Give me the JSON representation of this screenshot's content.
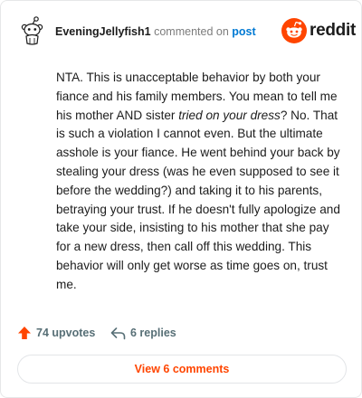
{
  "comment": {
    "username": "EveningJellyfish1",
    "action_text": "commented on",
    "post_link": "post",
    "body_part1": "NTA. This is unacceptable behavior by both your fiance and his family members. You mean to tell me his mother AND sister ",
    "body_emphasis": "tried on your dress",
    "body_part2": "? No. That is such a violation I cannot even. But the ultimate asshole is your fiance. He went behind your back by stealing your dress (was he even supposed to see it before the wedding?) and taking it to his parents, betraying your trust. If he doesn't fully apologize and take your side, insisting to his mother that she pay for a new dress, then call off this wedding. This behavior will only get worse as time goes on, trust me."
  },
  "brand": {
    "wordmark": "reddit",
    "icon": "reddit-alien-logo",
    "color": "#ff4500"
  },
  "actions": {
    "upvotes_label": "74 upvotes",
    "replies_label": "6 replies"
  },
  "footer": {
    "view_comments_label": "View 6 comments"
  },
  "colors": {
    "accent": "#ff4500",
    "link": "#0079d3",
    "muted": "#576f76",
    "text": "#1c1c1c"
  }
}
